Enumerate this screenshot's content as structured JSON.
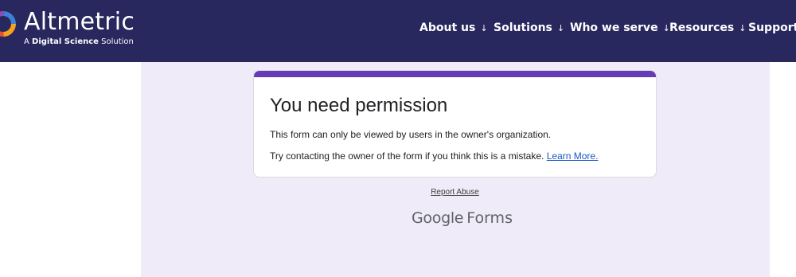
{
  "header": {
    "brand": "Altmetric",
    "tagline_prefix": "A ",
    "tagline_bold": "Digital Science",
    "tagline_suffix": " Solution",
    "logo_icon": "altmetric-ring-icon",
    "colors": {
      "background": "#28275e",
      "text": "#ffffff"
    },
    "nav": [
      {
        "label": "About us",
        "arrow": "↓"
      },
      {
        "label": "Solutions",
        "arrow": "↓"
      },
      {
        "label": "Who we serve",
        "arrow": "↓"
      },
      {
        "label": "Resources",
        "arrow": "↓"
      },
      {
        "label": "Support",
        "arrow": "↓"
      }
    ]
  },
  "main": {
    "background_color": "#efebf8",
    "card": {
      "accent_color": "#673ab7",
      "title": "You need permission",
      "line1": "This form can only be viewed by users in the owner's organization.",
      "line2": "Try contacting the owner of the form if you think this is a mistake.",
      "link": "Learn More."
    },
    "report_abuse": "Report Abuse",
    "footer_brand_google": "Google",
    "footer_brand_forms": "Forms"
  }
}
